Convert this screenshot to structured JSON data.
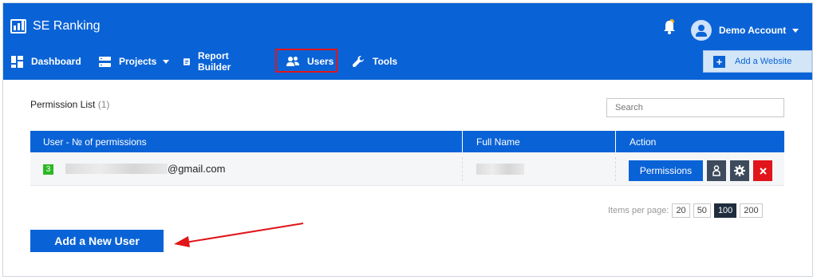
{
  "brand": {
    "name": "SE Ranking"
  },
  "account": {
    "name": "Demo Account"
  },
  "nav": {
    "items": [
      {
        "label": "Dashboard",
        "icon": "dashboard-icon"
      },
      {
        "label": "Projects",
        "icon": "projects-icon",
        "dropdown": true
      },
      {
        "label": "Report Builder",
        "icon": "report-icon"
      },
      {
        "label": "Users",
        "icon": "users-icon",
        "highlighted": true
      },
      {
        "label": "Tools",
        "icon": "wrench-icon"
      }
    ],
    "add_website_label": "Add a Website"
  },
  "permission_list": {
    "title": "Permission List",
    "count": "(1)",
    "search_placeholder": "Search",
    "columns": [
      "User - № of permissions",
      "Full Name",
      "Action"
    ],
    "rows": [
      {
        "permissions_count": "3",
        "email_suffix": "@gmail.com",
        "action_label": "Permissions"
      }
    ]
  },
  "pagination": {
    "label": "Items per page:",
    "options": [
      "20",
      "50",
      "100",
      "200"
    ],
    "selected": "100"
  },
  "add_user_label": "Add a New User",
  "colors": {
    "primary": "#0a63d6",
    "highlight": "#e0161b",
    "success": "#2db825",
    "danger": "#e0161b",
    "dark": "#3d4b5c"
  }
}
